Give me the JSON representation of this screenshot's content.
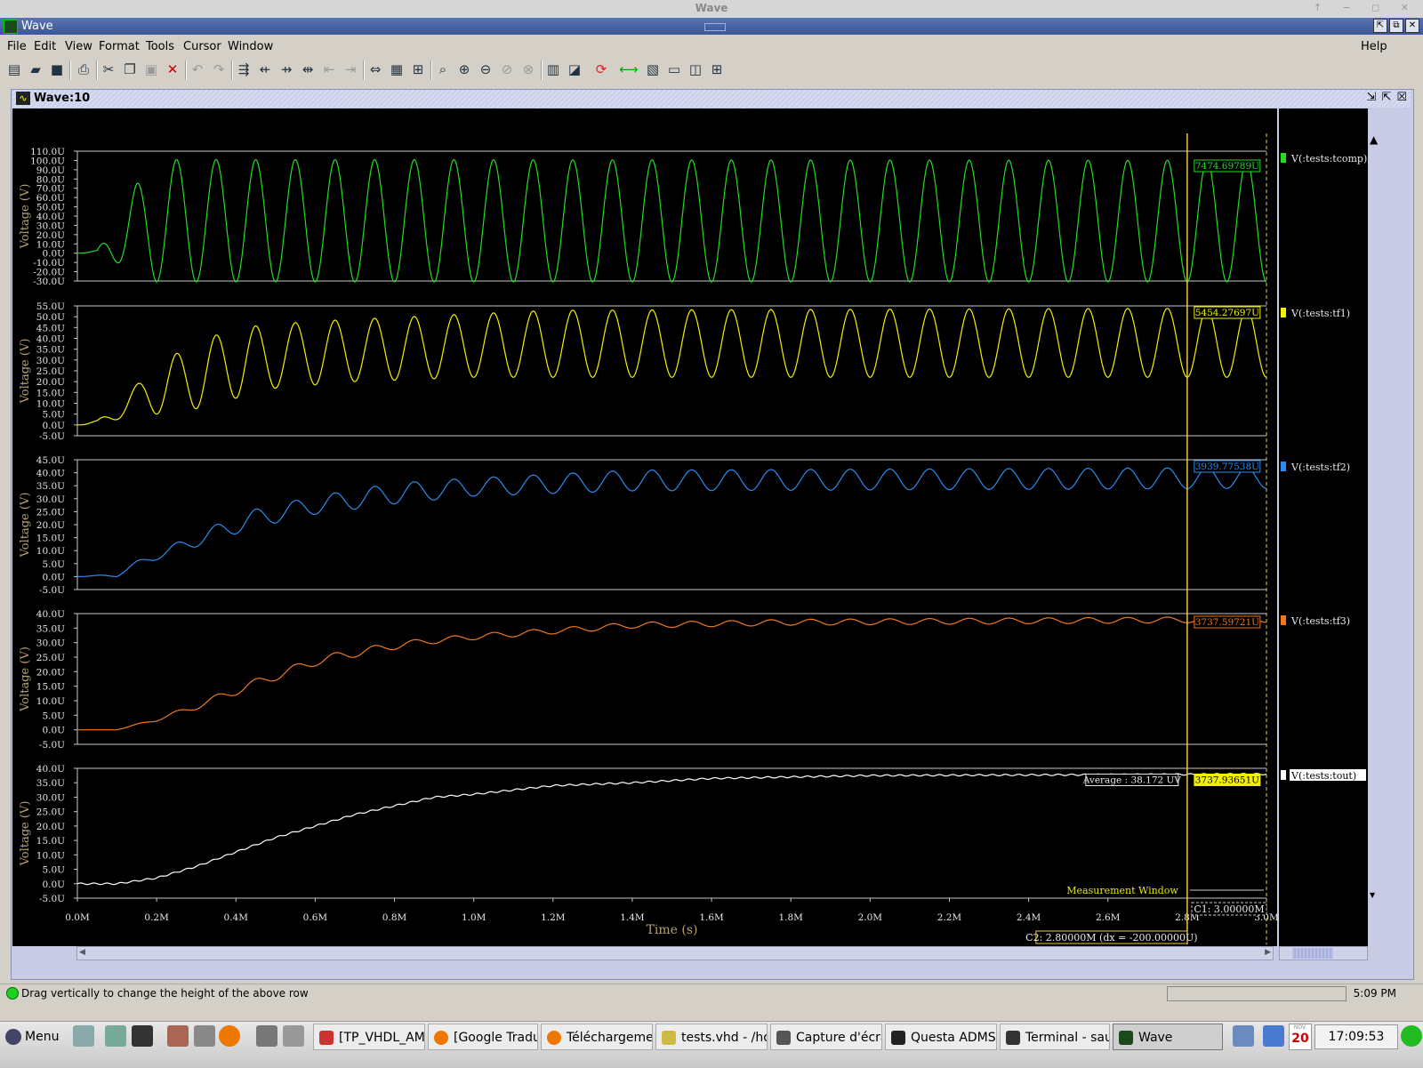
{
  "window": {
    "os_title": "Wave",
    "app_title": "Wave"
  },
  "menu": [
    "File",
    "Edit",
    "View",
    "Format",
    "Tools",
    "Cursor",
    "Window"
  ],
  "menu_help": "Help",
  "panel": {
    "title": "Wave:10"
  },
  "status": {
    "message": "Drag vertically to change the height of the above row",
    "time": "5:09 PM"
  },
  "taskbar": {
    "menu": "Menu",
    "tasks": [
      "[TP_VHDL_AMS...",
      "[Google Tradu...",
      "Téléchargeme...",
      "tests.vhd - /ho...",
      "Capture d'écran",
      "Questa ADMS ...",
      "Terminal - sau...",
      "Wave"
    ],
    "clock": "17:09:53",
    "date_day": "20",
    "date_month": "NOV."
  },
  "colors": {
    "tcomp": "#22dd22",
    "tf1": "#f2f200",
    "tf2": "#2a8cf0",
    "tf3": "#f07818",
    "tout": "#ffffff",
    "axis": "#b8a070",
    "cursor": "#f0c848"
  },
  "chart_data": {
    "type": "line",
    "xlabel": "Time (s)",
    "xlim": [
      0,
      3.0
    ],
    "x_unit": "M",
    "x_ticks": [
      "0.0M",
      "0.2M",
      "0.4M",
      "0.6M",
      "0.8M",
      "1.0M",
      "1.2M",
      "1.4M",
      "1.6M",
      "1.8M",
      "2.0M",
      "2.2M",
      "2.4M",
      "2.6M",
      "2.8M",
      "3.0M"
    ],
    "period": 0.1,
    "series": [
      {
        "key": "tcomp",
        "name": "V(:tests:tcomp)",
        "ylabel": "Voltage (V)",
        "yticks": [
          "110.0U",
          "100.0U",
          "90.0U",
          "80.0U",
          "70.0U",
          "60.0U",
          "50.0U",
          "40.0U",
          "30.0U",
          "20.0U",
          "10.0U",
          "0.0U",
          "-10.0U",
          "-20.0U",
          "-30.0U"
        ],
        "ylim": [
          -30,
          110
        ],
        "readout": "7474.69789U",
        "envelope": [
          [
            0,
            0
          ],
          [
            0.05,
            3
          ],
          [
            0.1,
            40
          ],
          [
            0.15,
            75
          ],
          [
            0.2,
            95
          ],
          [
            0.25,
            101
          ],
          [
            3.0,
            100
          ]
        ],
        "lower": [
          [
            0,
            0
          ],
          [
            0.05,
            0
          ],
          [
            0.1,
            -10
          ],
          [
            0.15,
            -25
          ],
          [
            0.2,
            -31
          ],
          [
            3.0,
            -31
          ]
        ]
      },
      {
        "key": "tf1",
        "name": "V(:tests:tf1)",
        "ylabel": "Voltage (V)",
        "yticks": [
          "55.0U",
          "50.0U",
          "45.0U",
          "40.0U",
          "35.0U",
          "30.0U",
          "25.0U",
          "20.0U",
          "15.0U",
          "10.0U",
          "5.0U",
          "0.0U",
          "-5.0U"
        ],
        "ylim": [
          -5,
          55
        ],
        "readout": "5454.27697U",
        "envelope": [
          [
            0,
            0
          ],
          [
            0.05,
            2
          ],
          [
            0.12,
            13
          ],
          [
            0.2,
            28
          ],
          [
            0.3,
            38
          ],
          [
            0.4,
            45
          ],
          [
            0.6,
            48
          ],
          [
            1.2,
            53
          ],
          [
            3.0,
            54
          ]
        ],
        "lower": [
          [
            0,
            0
          ],
          [
            0.05,
            0
          ],
          [
            0.15,
            5
          ],
          [
            0.25,
            5
          ],
          [
            0.35,
            10
          ],
          [
            0.5,
            17
          ],
          [
            0.7,
            20
          ],
          [
            1.0,
            22
          ],
          [
            3.0,
            22
          ]
        ]
      },
      {
        "key": "tf2",
        "name": "V(:tests:tf2)",
        "ylabel": "Voltage (V)",
        "yticks": [
          "45.0U",
          "40.0U",
          "35.0U",
          "30.0U",
          "25.0U",
          "20.0U",
          "15.0U",
          "10.0U",
          "5.0U",
          "0.0U",
          "-5.0U"
        ],
        "ylim": [
          -5,
          45
        ],
        "readout": "3939.77538U",
        "envelope": [
          [
            0,
            0
          ],
          [
            0.1,
            1
          ],
          [
            0.15,
            6
          ],
          [
            0.25,
            13
          ],
          [
            0.35,
            20
          ],
          [
            0.45,
            26
          ],
          [
            0.6,
            31
          ],
          [
            0.8,
            36
          ],
          [
            1.0,
            38
          ],
          [
            1.4,
            41
          ],
          [
            3.0,
            42
          ]
        ],
        "lower": [
          [
            0,
            0
          ],
          [
            0.1,
            0
          ],
          [
            0.15,
            4
          ],
          [
            0.25,
            9
          ],
          [
            0.35,
            14
          ],
          [
            0.45,
            19
          ],
          [
            0.6,
            24
          ],
          [
            0.8,
            28
          ],
          [
            1.0,
            31
          ],
          [
            1.4,
            33
          ],
          [
            3.0,
            34
          ]
        ]
      },
      {
        "key": "tf3",
        "name": "V(:tests:tf3)",
        "ylabel": "Voltage (V)",
        "yticks": [
          "40.0U",
          "35.0U",
          "30.0U",
          "25.0U",
          "20.0U",
          "15.0U",
          "10.0U",
          "5.0U",
          "0.0U",
          "-5.0U"
        ],
        "ylim": [
          -5,
          40
        ],
        "readout": "3737.59721U",
        "envelope": [
          [
            0,
            0
          ],
          [
            0.1,
            0
          ],
          [
            0.2,
            4
          ],
          [
            0.3,
            9
          ],
          [
            0.4,
            15
          ],
          [
            0.5,
            20
          ],
          [
            0.6,
            25
          ],
          [
            0.7,
            28
          ],
          [
            0.85,
            31
          ],
          [
            1.0,
            33
          ],
          [
            1.4,
            37
          ],
          [
            1.8,
            38
          ],
          [
            3.0,
            39
          ]
        ],
        "lower": [
          [
            0,
            0
          ],
          [
            0.1,
            0
          ],
          [
            0.2,
            3
          ],
          [
            0.3,
            7
          ],
          [
            0.4,
            12
          ],
          [
            0.5,
            17
          ],
          [
            0.6,
            22
          ],
          [
            0.7,
            25
          ],
          [
            0.85,
            29
          ],
          [
            1.0,
            31
          ],
          [
            1.4,
            35
          ],
          [
            1.8,
            36
          ],
          [
            3.0,
            37
          ]
        ]
      },
      {
        "key": "tout",
        "name": "V(:tests:tout)",
        "ylabel": "Voltage (V)",
        "yticks": [
          "40.0U",
          "35.0U",
          "30.0U",
          "25.0U",
          "20.0U",
          "15.0U",
          "10.0U",
          "5.0U",
          "0.0U",
          "-5.0U"
        ],
        "ylim": [
          -5,
          40
        ],
        "readout": "3737.93651U",
        "average": "Average : 38.172 UV",
        "envelope": [
          [
            0,
            0
          ],
          [
            0.1,
            0
          ],
          [
            0.2,
            2
          ],
          [
            0.3,
            6
          ],
          [
            0.4,
            11
          ],
          [
            0.5,
            16
          ],
          [
            0.6,
            20
          ],
          [
            0.7,
            24
          ],
          [
            0.8,
            27
          ],
          [
            0.9,
            30
          ],
          [
            1.0,
            31
          ],
          [
            1.2,
            34
          ],
          [
            1.4,
            35
          ],
          [
            1.6,
            36.5
          ],
          [
            2.0,
            37.5
          ],
          [
            3.0,
            38
          ]
        ],
        "lower": [
          [
            0,
            0
          ],
          [
            0.1,
            0
          ],
          [
            0.2,
            2
          ],
          [
            0.3,
            6
          ],
          [
            0.4,
            11
          ],
          [
            0.5,
            16
          ],
          [
            0.6,
            20
          ],
          [
            0.7,
            24
          ],
          [
            0.8,
            27
          ],
          [
            0.9,
            30
          ],
          [
            1.0,
            31
          ],
          [
            1.2,
            34
          ],
          [
            1.4,
            35
          ],
          [
            1.6,
            36.5
          ],
          [
            2.0,
            37.5
          ],
          [
            3.0,
            38
          ]
        ]
      }
    ],
    "cursors": {
      "c1": {
        "label": "C1: 3.00000M",
        "x": 3.0
      },
      "c2": {
        "label": "C2: 2.80000M (dx = -200.00000U)",
        "x": 2.8
      },
      "measurement_label": "Measurement Window"
    }
  }
}
